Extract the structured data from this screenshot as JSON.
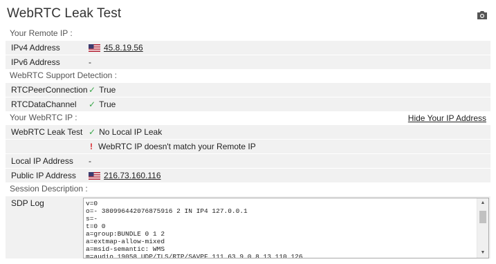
{
  "title": "WebRTC Leak Test",
  "sections": {
    "remote_ip": "Your Remote IP :",
    "support": "WebRTC Support Detection :",
    "webrtc_ip": "Your WebRTC IP :",
    "session": "Session Description :"
  },
  "hide_link": "Hide Your IP Address",
  "remote": {
    "ipv4_label": "IPv4 Address",
    "ipv4_value": "45.8.19.56",
    "ipv6_label": "IPv6 Address",
    "ipv6_value": "-"
  },
  "support": {
    "peer_label": "RTCPeerConnection",
    "peer_value": "True",
    "data_label": "RTCDataChannel",
    "data_value": "True"
  },
  "webrtc": {
    "leak_label": "WebRTC Leak Test",
    "leak_value": "No Local IP Leak",
    "mismatch_value": "WebRTC IP doesn't match your Remote IP",
    "local_label": "Local IP Address",
    "local_value": "-",
    "public_label": "Public IP Address",
    "public_value": "216.73.160.116"
  },
  "sdp": {
    "label": "SDP Log",
    "text": "v=0\no=- 380996442076875916 2 IN IP4 127.0.0.1\ns=-\nt=0 0\na=group:BUNDLE 0 1 2\na=extmap-allow-mixed\na=msid-semantic: WMS\nm=audio 19058 UDP/TLS/RTP/SAVPF 111 63 9 0 8 13 110 126"
  },
  "icons": {
    "camera": "camera-icon",
    "flag": "us-flag-icon",
    "check": "check-icon",
    "warning": "exclamation-icon"
  },
  "colors": {
    "check": "#3aa64a",
    "warning": "#d9242a",
    "row_bg": "#f1f1f1"
  }
}
